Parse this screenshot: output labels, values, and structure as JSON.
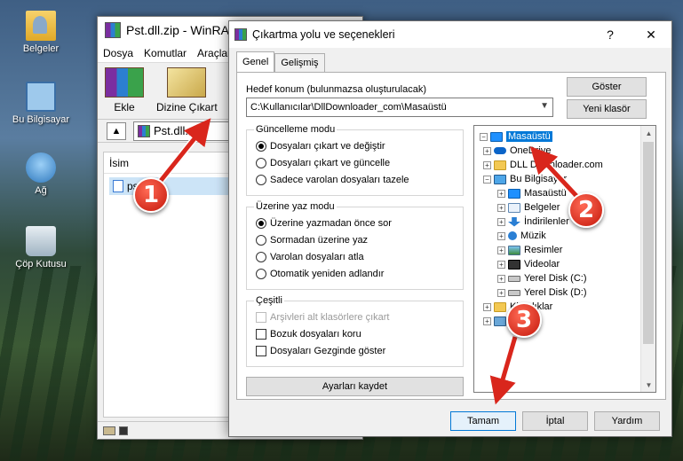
{
  "desktop": {
    "icons": [
      {
        "label": "Belgeler",
        "icon": "folder-user-icon"
      },
      {
        "label": "Bu Bilgisayar",
        "icon": "computer-icon"
      },
      {
        "label": "Ağ",
        "icon": "network-icon"
      },
      {
        "label": "Çöp Kutusu",
        "icon": "recycle-bin-icon"
      }
    ]
  },
  "winrar": {
    "title": "Pst.dll.zip - WinRAR",
    "menu": [
      "Dosya",
      "Komutlar",
      "Araçlar"
    ],
    "toolbar": {
      "add_label": "Ekle",
      "extract_label": "Dizine Çıkart"
    },
    "path": "Pst.dll.zip",
    "list_header": "İsim",
    "list_item": "pst"
  },
  "dialog": {
    "title": "Çıkartma yolu ve seçenekleri",
    "help_btn": "?",
    "close_btn": "✕",
    "tabs": [
      "Genel",
      "Gelişmiş"
    ],
    "dest_label": "Hedef konum (bulunmazsa oluşturulacak)",
    "dest_value": "C:\\Kullanıcılar\\DllDownloader_com\\Masaüstü",
    "show_btn": "Göster",
    "new_folder_btn": "Yeni klasör",
    "update_mode": {
      "title": "Güncelleme modu",
      "options": [
        "Dosyaları çıkart ve değiştir",
        "Dosyaları çıkart ve güncelle",
        "Sadece varolan dosyaları tazele"
      ],
      "selected": 0
    },
    "overwrite_mode": {
      "title": "Üzerine yaz modu",
      "options": [
        "Üzerine yazmadan önce sor",
        "Sormadan üzerine yaz",
        "Varolan dosyaları atla",
        "Otomatik yeniden adlandır"
      ],
      "selected": 0
    },
    "misc": {
      "title": "Çeşitli",
      "options": [
        "Arşivleri alt klasörlere çıkart",
        "Bozuk dosyaları koru",
        "Dosyaları Gezginde göster"
      ]
    },
    "save_settings_btn": "Ayarları kaydet",
    "tree": [
      {
        "label": "Masaüstü",
        "icon": "desktop-icon",
        "expander": "−"
      },
      {
        "label": "OneDrive",
        "icon": "onedrive-icon",
        "expander": "+"
      },
      {
        "label": "DLL Downloader.com",
        "icon": "user-icon",
        "expander": "+"
      },
      {
        "label": "Bu Bilgisayar",
        "icon": "computer-icon",
        "expander": "−"
      },
      {
        "label": "Masaüstü",
        "icon": "desktop-icon",
        "expander": "+"
      },
      {
        "label": "Belgeler",
        "icon": "documents-icon",
        "expander": "+"
      },
      {
        "label": "İndirilenler",
        "icon": "downloads-icon",
        "expander": "+"
      },
      {
        "label": "Müzik",
        "icon": "music-icon",
        "expander": "+"
      },
      {
        "label": "Resimler",
        "icon": "pictures-icon",
        "expander": "+"
      },
      {
        "label": "Videolar",
        "icon": "videos-icon",
        "expander": "+"
      },
      {
        "label": "Yerel Disk (C:)",
        "icon": "disk-icon",
        "expander": "+"
      },
      {
        "label": "Yerel Disk (D:)",
        "icon": "disk-icon",
        "expander": "+"
      },
      {
        "label": "Kitaplıklar",
        "icon": "libraries-icon",
        "expander": "+"
      },
      {
        "label": "Ağ",
        "icon": "network-icon",
        "expander": "+"
      }
    ],
    "ok_btn": "Tamam",
    "cancel_btn": "İptal",
    "help_button_label": "Yardım"
  },
  "callouts": [
    "1",
    "2",
    "3"
  ],
  "colors": {
    "accent": "#0078d7",
    "callout": "#d9261c"
  }
}
